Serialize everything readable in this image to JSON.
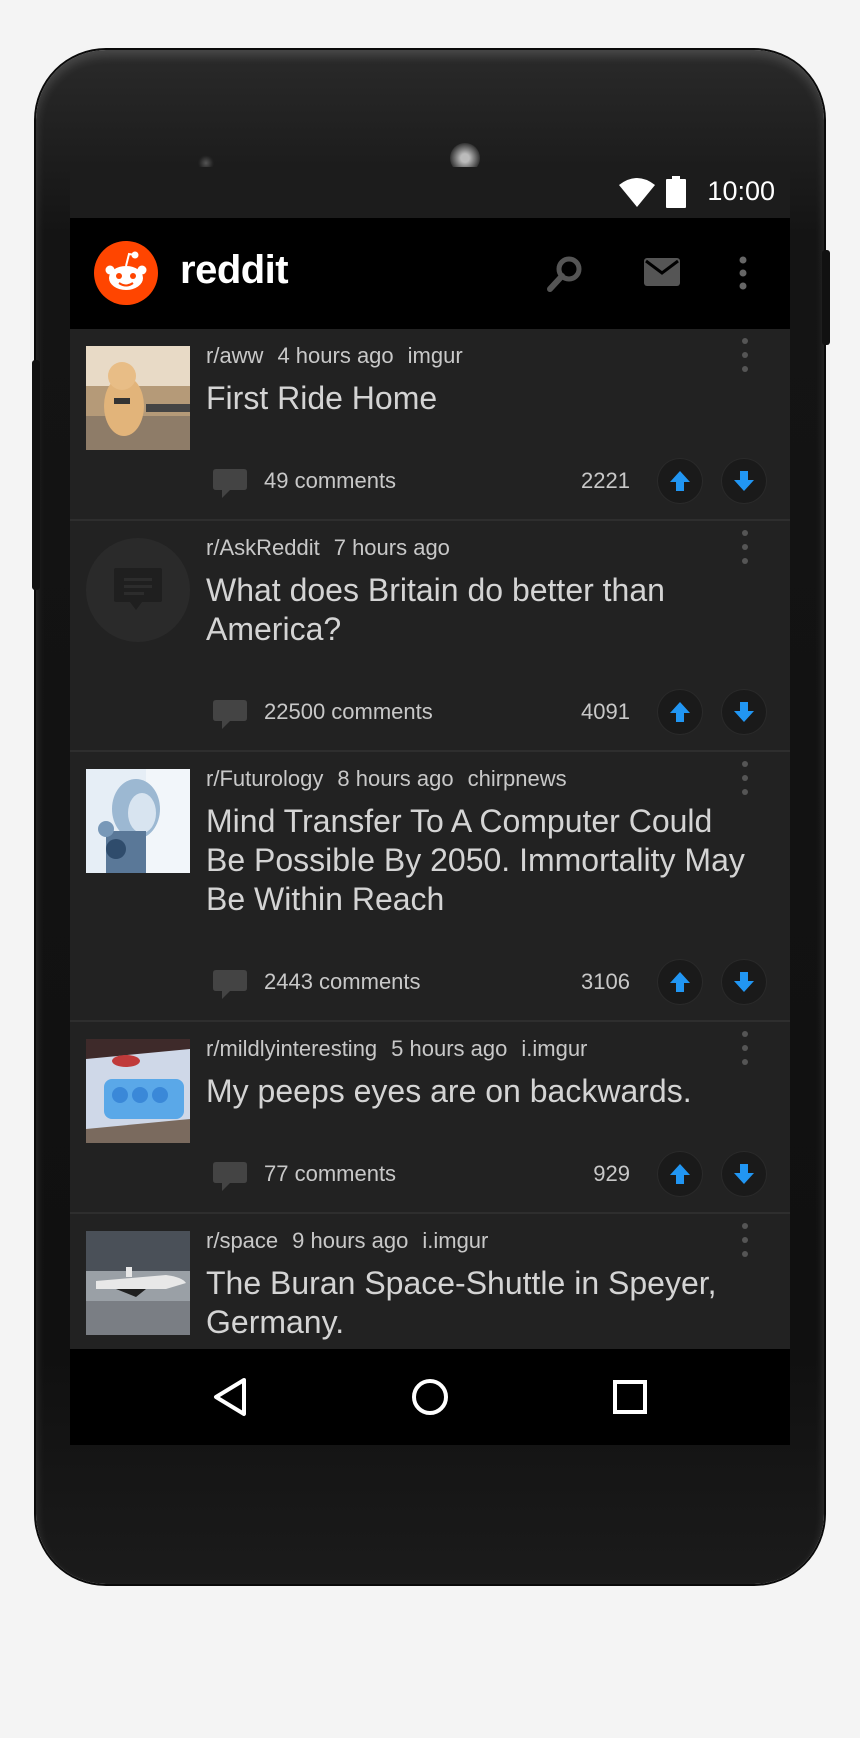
{
  "status": {
    "time": "10:00"
  },
  "appbar": {
    "title": "reddit"
  },
  "colors": {
    "accent": "#2196f3",
    "brand": "#ff4500",
    "background": "#202020"
  },
  "posts": [
    {
      "subreddit": "r/aww",
      "age": "4 hours ago",
      "domain": "imgur",
      "title": "First Ride Home",
      "comments": "49 comments",
      "score": "2221",
      "thumb": "dog"
    },
    {
      "subreddit": "r/AskReddit",
      "age": "7 hours ago",
      "domain": "",
      "title": "What does Britain do better than America?",
      "comments": "22500 comments",
      "score": "4091",
      "thumb": "text-post"
    },
    {
      "subreddit": "r/Futurology",
      "age": "8 hours ago",
      "domain": "chirpnews",
      "title": "Mind Transfer To A Computer Could Be Possible By 2050. Immortality May Be Within Reach",
      "comments": "2443 comments",
      "score": "3106",
      "thumb": "robot"
    },
    {
      "subreddit": "r/mildlyinteresting",
      "age": "5 hours ago",
      "domain": "i.imgur",
      "title": "My peeps eyes are on backwards.",
      "comments": "77 comments",
      "score": "929",
      "thumb": "peeps"
    },
    {
      "subreddit": "r/space",
      "age": "9 hours ago",
      "domain": "i.imgur",
      "title": "The Buran Space-Shuttle in Speyer, Germany.",
      "comments": "",
      "score": "",
      "thumb": "shuttle"
    }
  ]
}
